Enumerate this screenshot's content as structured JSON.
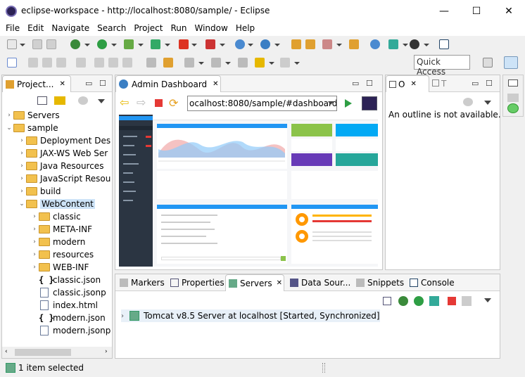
{
  "window": {
    "title": "eclipse-workspace - http://localhost:8080/sample/ - Eclipse",
    "min": "—",
    "max": "☐",
    "close": "✕"
  },
  "menu": [
    "File",
    "Edit",
    "Navigate",
    "Search",
    "Project",
    "Run",
    "Window",
    "Help"
  ],
  "quick_access": "Quick Access",
  "project_explorer": {
    "tab": "Project...",
    "items": [
      {
        "label": "Servers",
        "indent": 0,
        "arrow": "›",
        "icon": "folder"
      },
      {
        "label": "sample",
        "indent": 0,
        "arrow": "⌄",
        "icon": "folder"
      },
      {
        "label": "Deployment Des",
        "indent": 1,
        "arrow": "›",
        "icon": "folder"
      },
      {
        "label": "JAX-WS Web Ser",
        "indent": 1,
        "arrow": "›",
        "icon": "folder"
      },
      {
        "label": "Java Resources",
        "indent": 1,
        "arrow": "›",
        "icon": "folder"
      },
      {
        "label": "JavaScript Resou",
        "indent": 1,
        "arrow": "›",
        "icon": "folder"
      },
      {
        "label": "build",
        "indent": 1,
        "arrow": "›",
        "icon": "folder"
      },
      {
        "label": "WebContent",
        "indent": 1,
        "arrow": "⌄",
        "icon": "folder"
      },
      {
        "label": "classic",
        "indent": 2,
        "arrow": "›",
        "icon": "folder"
      },
      {
        "label": "META-INF",
        "indent": 2,
        "arrow": "›",
        "icon": "folder"
      },
      {
        "label": "modern",
        "indent": 2,
        "arrow": "›",
        "icon": "folder"
      },
      {
        "label": "resources",
        "indent": 2,
        "arrow": "›",
        "icon": "folder"
      },
      {
        "label": "WEB-INF",
        "indent": 2,
        "arrow": "›",
        "icon": "folder"
      },
      {
        "label": "classic.json",
        "indent": 2,
        "arrow": "",
        "icon": "json"
      },
      {
        "label": "classic.jsonp",
        "indent": 2,
        "arrow": "",
        "icon": "file"
      },
      {
        "label": "index.html",
        "indent": 2,
        "arrow": "",
        "icon": "file"
      },
      {
        "label": "modern.json",
        "indent": 2,
        "arrow": "",
        "icon": "json"
      },
      {
        "label": "modern.jsonp",
        "indent": 2,
        "arrow": "",
        "icon": "file"
      }
    ]
  },
  "editor": {
    "tab": "Admin Dashboard",
    "url": "ocalhost:8080/sample/#dashboard"
  },
  "outline": {
    "tab1": "O",
    "tab2": "T",
    "message": "An outline is not available."
  },
  "bottom": {
    "tabs": [
      "Markers",
      "Properties",
      "Servers",
      "Data Sour...",
      "Snippets",
      "Console"
    ],
    "server": "Tomcat v8.5 Server at localhost  [Started, Synchronized]"
  },
  "status": "1 item selected",
  "colors": {
    "accent": "#2196f3",
    "dark_sidebar": "#2b3542",
    "red": "#e53935",
    "green": "#2e9e44"
  }
}
